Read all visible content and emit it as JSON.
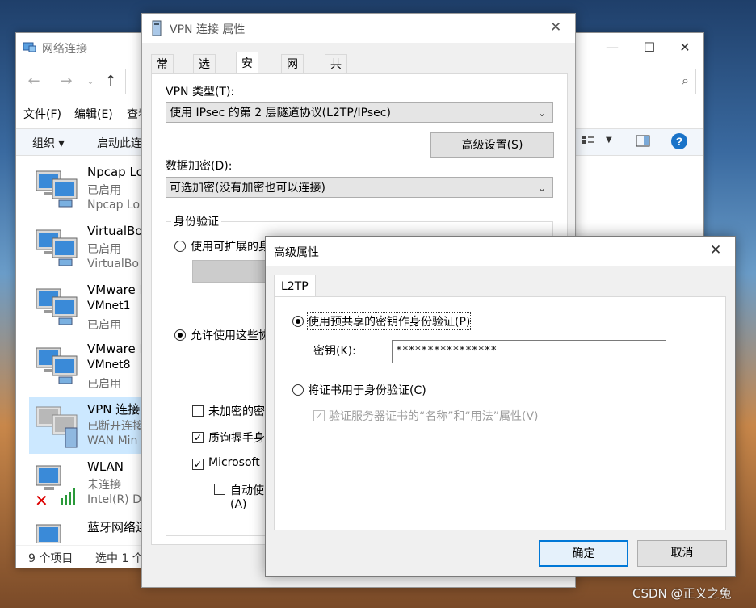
{
  "explorer": {
    "title": "网络连接",
    "menu": [
      "文件(F)",
      "编辑(E)",
      "查看"
    ],
    "toolbar": {
      "organize": "组织 ▾",
      "start": "启动此连"
    },
    "items": [
      {
        "name": "Npcap Lo",
        "line2": "已启用",
        "line3": "Npcap Lo"
      },
      {
        "name": "VirtualBo",
        "line2": "已启用",
        "line3": "VirtualBo"
      },
      {
        "name": "VMware N",
        "line2": "VMnet1",
        "line3": "已启用"
      },
      {
        "name": "VMware N",
        "line2": "VMnet8",
        "line3": "已启用"
      },
      {
        "name": "VPN 连接",
        "line2": "已断开连接",
        "line3": "WAN Min"
      },
      {
        "name": "WLAN",
        "line2": "未连接",
        "line3": "Intel(R) D"
      },
      {
        "name": "蓝牙网络连",
        "line2": "",
        "line3": ""
      }
    ],
    "status": {
      "count": "9 个项目",
      "selected": "选中 1 个"
    }
  },
  "vpn_dialog": {
    "title": "VPN 连接 属性",
    "tabs": [
      "常规",
      "选项",
      "安全",
      "网络",
      "共享"
    ],
    "active_tab": "安全",
    "vpn_type_label": "VPN 类型(T):",
    "vpn_type_value": "使用 IPsec 的第 2 层隧道协议(L2TP/IPsec)",
    "advanced_button": "高级设置(S)",
    "encryption_label": "数据加密(D):",
    "encryption_value": "可选加密(没有加密也可以连接)",
    "auth_group": "身份验证",
    "auth_eap": "使用可扩展的身",
    "auth_allow": "允许使用这些协",
    "protocols": [
      {
        "label": "未加密的密",
        "checked": false
      },
      {
        "label": "质询握手身",
        "checked": true
      },
      {
        "label": "Microsoft",
        "checked": true
      }
    ],
    "auto_use": "自动使",
    "auto_use_hint": "(A)"
  },
  "adv_dialog": {
    "title": "高级属性",
    "tab": "L2TP",
    "psk_radio": "使用预共享的密钥作身份验证(P)",
    "key_label": "密钥(K):",
    "key_value": "****************",
    "cert_radio": "将证书用于身份验证(C)",
    "verify_checkbox": "验证服务器证书的“名称”和“用法”属性(V)",
    "ok": "确定",
    "cancel": "取消"
  },
  "watermark": "CSDN @正义之兔",
  "colors": {
    "selection": "#cce8ff",
    "accent": "#0078d7",
    "help": "#1a73c8"
  }
}
